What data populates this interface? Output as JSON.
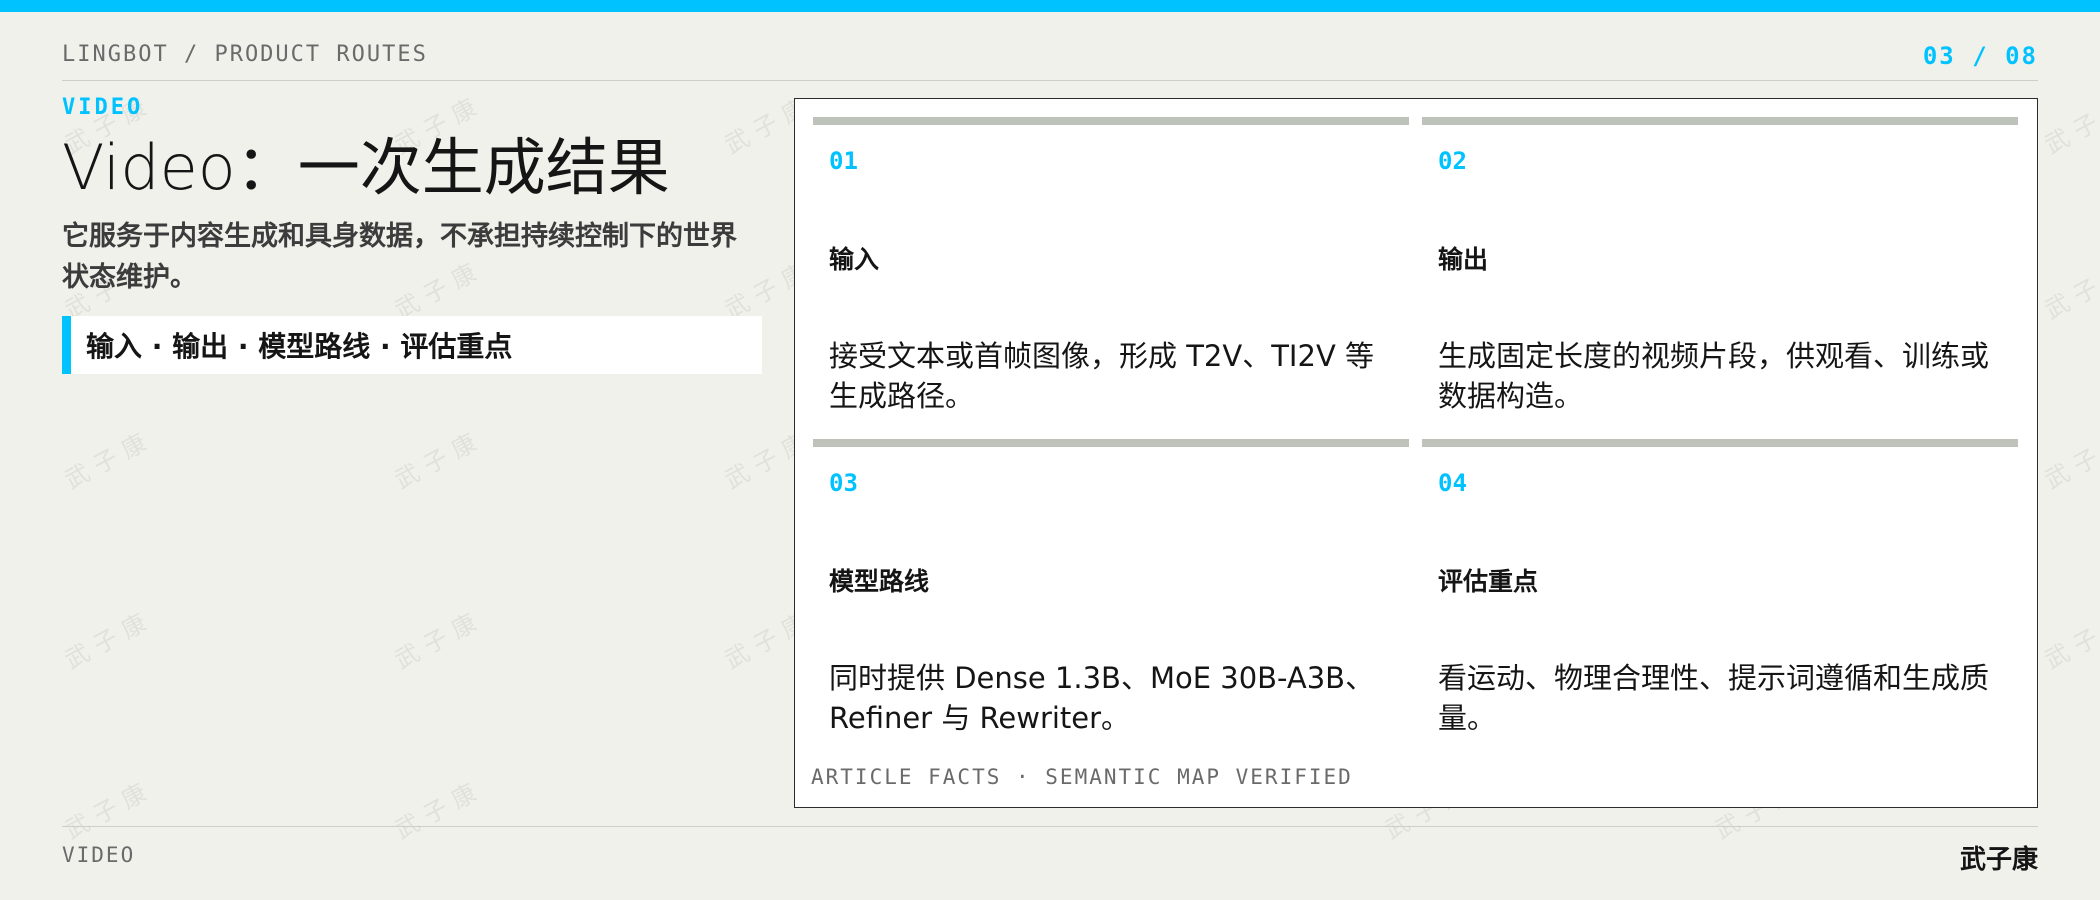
{
  "header": {
    "breadcrumb": "LINGBOT / PRODUCT ROUTES",
    "pager": "03 / 08"
  },
  "intro": {
    "kicker": "VIDEO",
    "title": "Video：一次生成结果",
    "subtitle": "它服务于内容生成和具身数据，不承担持续控制下的世界状态维护。",
    "pill": "输入 · 输出 · 模型路线 · 评估重点"
  },
  "cards": [
    {
      "num": "01",
      "label": "输入",
      "text": "接受文本或首帧图像，形成 T2V、TI2V 等生成路径。"
    },
    {
      "num": "02",
      "label": "输出",
      "text": "生成固定长度的视频片段，供观看、训练或数据构造。"
    },
    {
      "num": "03",
      "label": "模型路线",
      "text": "同时提供 Dense 1.3B、MoE 30B-A3B、Refiner 与 Rewriter。"
    },
    {
      "num": "04",
      "label": "评估重点",
      "text": "看运动、物理合理性、提示词遵循和生成质量。"
    }
  ],
  "panel": {
    "footnote": "ARTICLE FACTS · SEMANTIC MAP VERIFIED"
  },
  "footer": {
    "left": "VIDEO",
    "right": "武子康"
  },
  "watermark": "武子康",
  "colors": {
    "accent": "#00c2ff",
    "background": "#f1f1ec",
    "card_rule": "#bdc2ba"
  }
}
